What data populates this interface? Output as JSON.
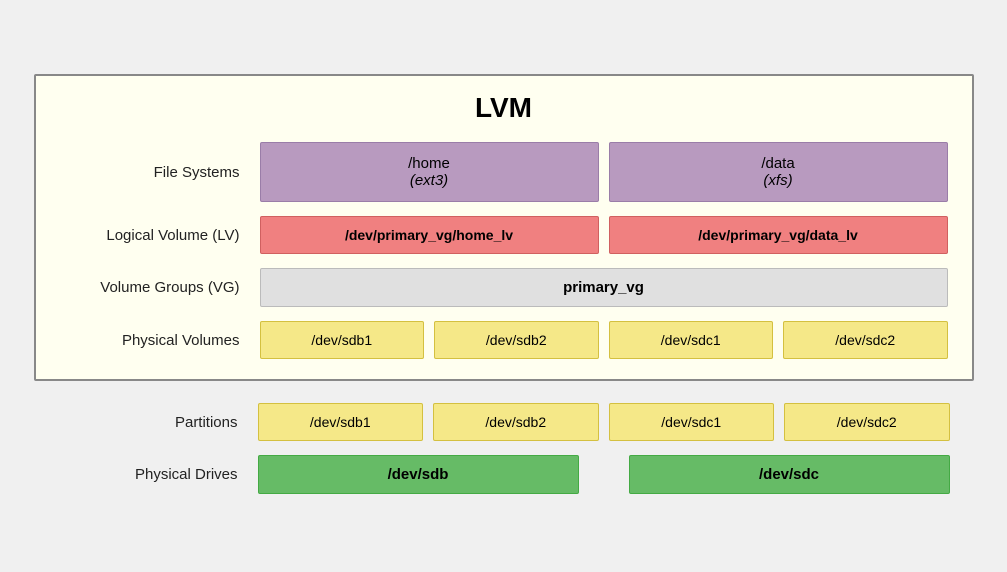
{
  "title": "LVM",
  "lvm_box": {
    "file_systems_label": "File Systems",
    "logical_volume_label": "Logical Volume (LV)",
    "volume_groups_label": "Volume Groups (VG)",
    "physical_volumes_label": "Physical Volumes",
    "file_systems": [
      {
        "name": "/home",
        "type": "ext3"
      },
      {
        "name": "/data",
        "type": "xfs"
      }
    ],
    "logical_volumes": [
      "/dev/primary_vg/home_lv",
      "/dev/primary_vg/data_lv"
    ],
    "volume_group": "primary_vg",
    "physical_volumes": [
      "/dev/sdb1",
      "/dev/sdb2",
      "/dev/sdc1",
      "/dev/sdc2"
    ]
  },
  "bottom_section": {
    "partitions_label": "Partitions",
    "physical_drives_label": "Physical Drives",
    "partitions": [
      "/dev/sdb1",
      "/dev/sdb2",
      "/dev/sdc1",
      "/dev/sdc2"
    ],
    "drives": [
      "/dev/sdb",
      "/dev/sdc"
    ]
  }
}
